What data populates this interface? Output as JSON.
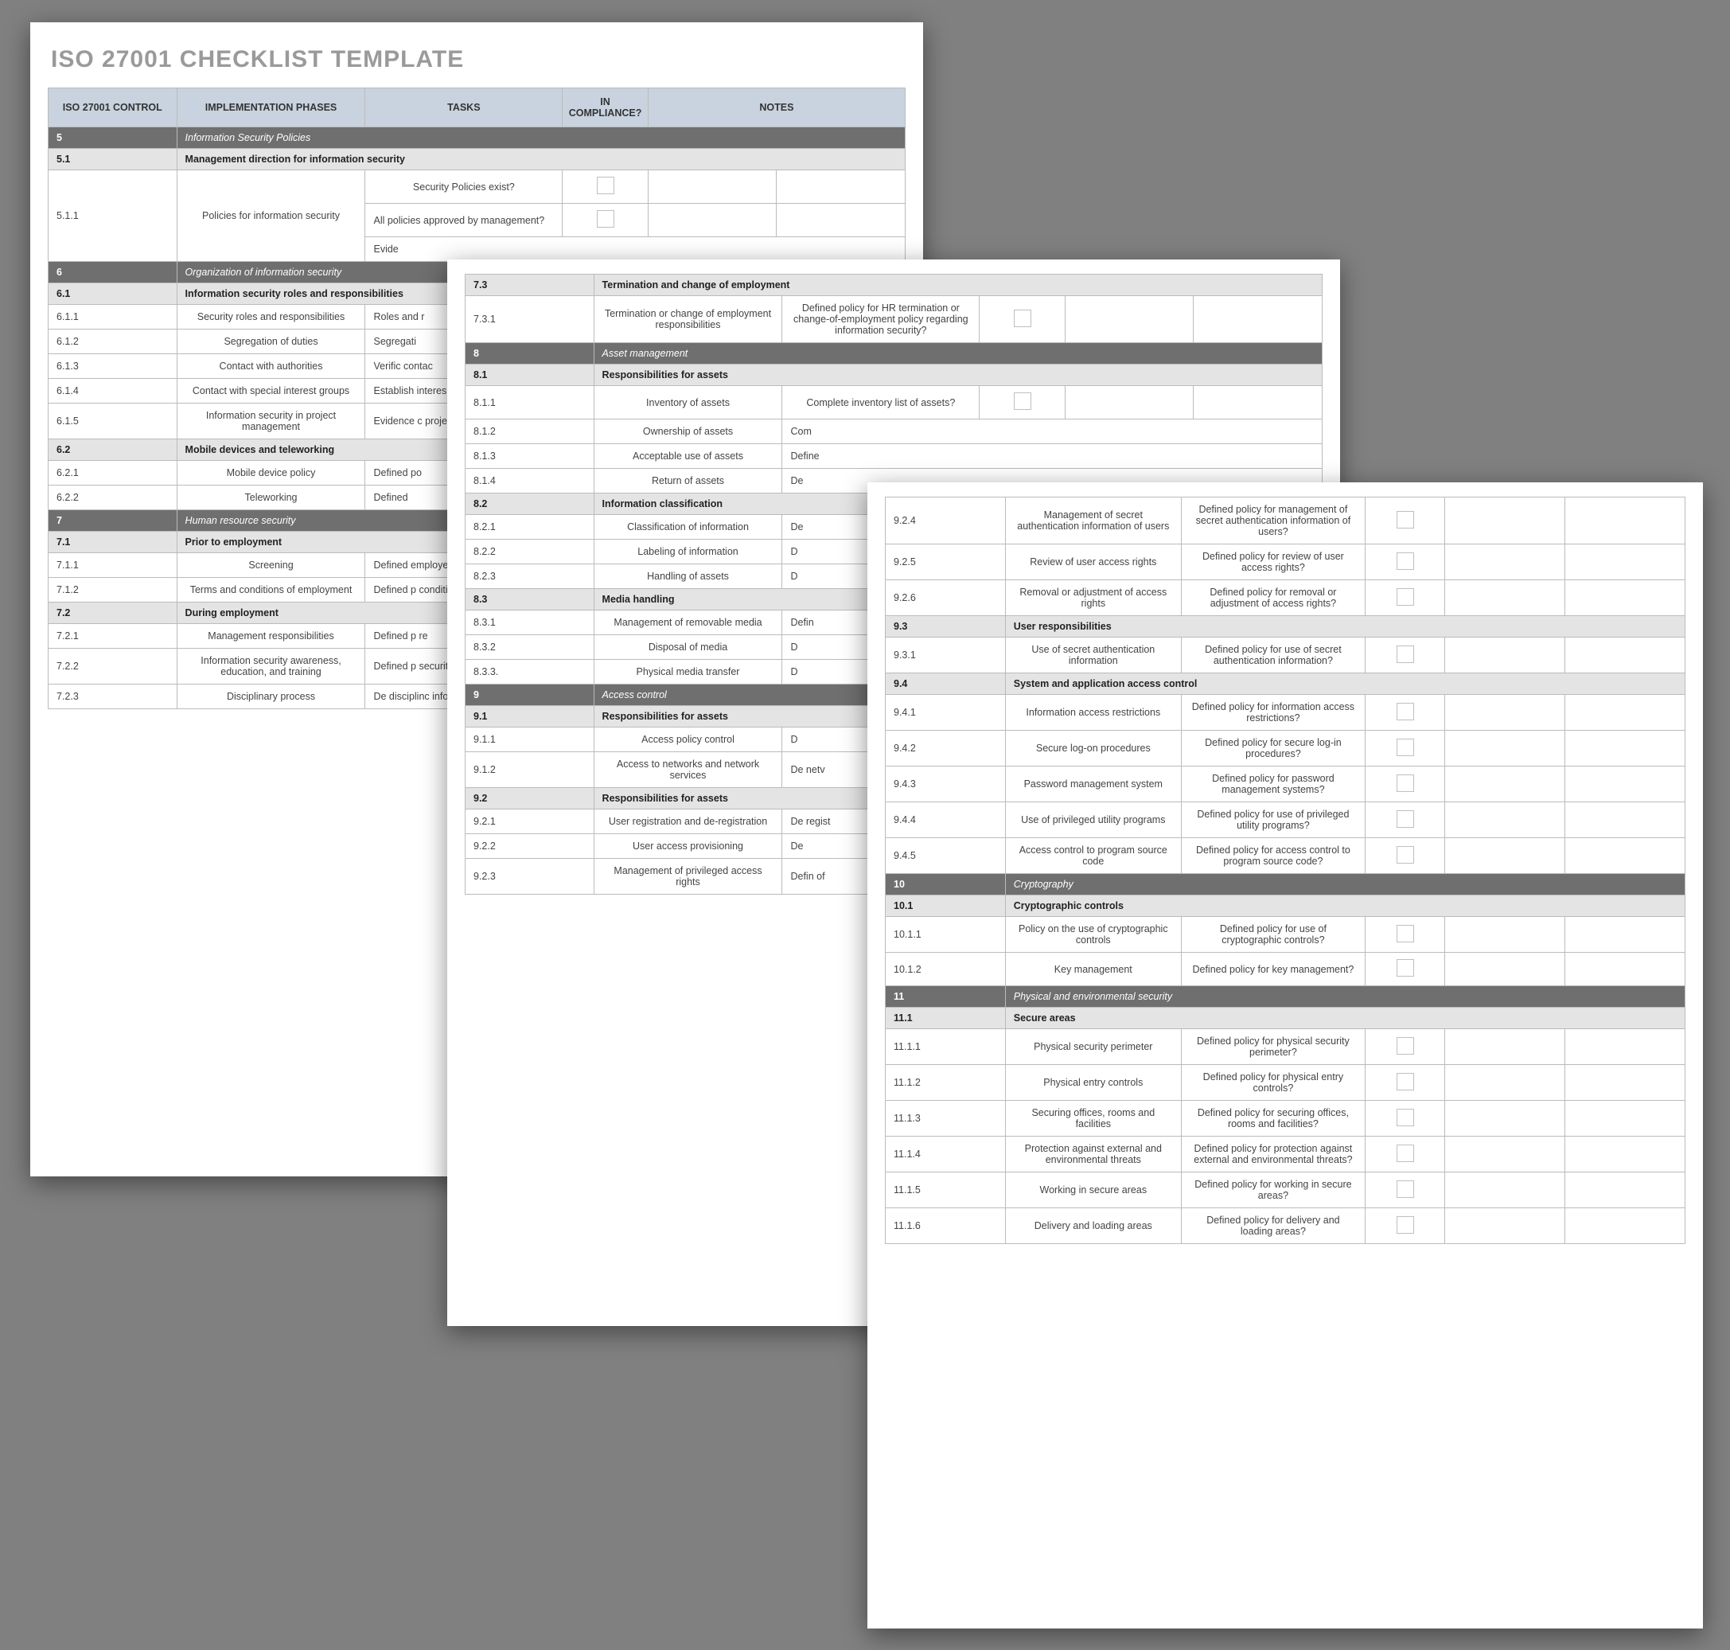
{
  "title": "ISO 27001 CHECKLIST TEMPLATE",
  "headers": {
    "control": "ISO 27001 CONTROL",
    "phases": "IMPLEMENTATION PHASES",
    "tasks": "TASKS",
    "compliance": "IN COMPLIANCE?",
    "notes": "NOTES"
  },
  "pageA": [
    {
      "t": "section",
      "id": "5",
      "label": "Information Security Policies"
    },
    {
      "t": "sub",
      "id": "5.1",
      "label": "Management direction for information security"
    },
    {
      "t": "row3",
      "id": "5.1.1",
      "phase": "Policies for information security",
      "task1": "Security Policies exist?",
      "task2": "All policies approved by management?",
      "task3": "Evide"
    },
    {
      "t": "section",
      "id": "6",
      "label": "Organization of information security"
    },
    {
      "t": "sub",
      "id": "6.1",
      "label": "Information security roles and responsibilities"
    },
    {
      "t": "row",
      "id": "6.1.1",
      "phase": "Security roles and responsibilities",
      "task": "Roles and r"
    },
    {
      "t": "row",
      "id": "6.1.2",
      "phase": "Segregation of duties",
      "task": "Segregati"
    },
    {
      "t": "row",
      "id": "6.1.3",
      "phase": "Contact with authorities",
      "task": "Verific\ncontac"
    },
    {
      "t": "row",
      "id": "6.1.4",
      "phase": "Contact with special interest groups",
      "task": "Establish\ninteres\nc"
    },
    {
      "t": "row",
      "id": "6.1.5",
      "phase": "Information security in project management",
      "task": "Evidence c\nproje"
    },
    {
      "t": "sub",
      "id": "6.2",
      "label": "Mobile devices and teleworking"
    },
    {
      "t": "row",
      "id": "6.2.1",
      "phase": "Mobile device policy",
      "task": "Defined po"
    },
    {
      "t": "row",
      "id": "6.2.2",
      "phase": "Teleworking",
      "task": "Defined"
    },
    {
      "t": "section",
      "id": "7",
      "label": "Human resource security"
    },
    {
      "t": "sub",
      "id": "7.1",
      "label": "Prior to employment"
    },
    {
      "t": "row",
      "id": "7.1.1",
      "phase": "Screening",
      "task": "Defined\nemployees"
    },
    {
      "t": "row",
      "id": "7.1.2",
      "phase": "Terms and conditions of employment",
      "task": "Defined p\nconditi"
    },
    {
      "t": "sub",
      "id": "7.2",
      "label": "During employment"
    },
    {
      "t": "row",
      "id": "7.2.1",
      "phase": "Management responsibilities",
      "task": "Defined p\nre"
    },
    {
      "t": "row",
      "id": "7.2.2",
      "phase": "Information security awareness, education, and training",
      "task": "Defined p\nsecurity c\nc"
    },
    {
      "t": "row",
      "id": "7.2.3",
      "phase": "Disciplinary process",
      "task": "De\ndisciplinc\ninfor"
    }
  ],
  "pageB": [
    {
      "t": "sub",
      "id": "7.3",
      "label": "Termination and change of employment"
    },
    {
      "t": "rowfull",
      "id": "7.3.1",
      "phase": "Termination or change of employment responsibilities",
      "task": "Defined policy for HR termination or change-of-employment policy regarding information security?"
    },
    {
      "t": "section",
      "id": "8",
      "label": "Asset management"
    },
    {
      "t": "sub",
      "id": "8.1",
      "label": "Responsibilities for assets"
    },
    {
      "t": "rowfull",
      "id": "8.1.1",
      "phase": "Inventory of assets",
      "task": "Complete inventory list of assets?"
    },
    {
      "t": "row",
      "id": "8.1.2",
      "phase": "Ownership of assets",
      "task": "Com"
    },
    {
      "t": "row",
      "id": "8.1.3",
      "phase": "Acceptable use of assets",
      "task": "Define"
    },
    {
      "t": "row",
      "id": "8.1.4",
      "phase": "Return of assets",
      "task": "De"
    },
    {
      "t": "sub",
      "id": "8.2",
      "label": "Information classification"
    },
    {
      "t": "row",
      "id": "8.2.1",
      "phase": "Classification of information",
      "task": "De"
    },
    {
      "t": "row",
      "id": "8.2.2",
      "phase": "Labeling of information",
      "task": "D"
    },
    {
      "t": "row",
      "id": "8.2.3",
      "phase": "Handling of assets",
      "task": "D"
    },
    {
      "t": "sub",
      "id": "8.3",
      "label": "Media handling"
    },
    {
      "t": "row",
      "id": "8.3.1",
      "phase": "Management of removable media",
      "task": "Defin"
    },
    {
      "t": "row",
      "id": "8.3.2",
      "phase": "Disposal of media",
      "task": "D"
    },
    {
      "t": "row",
      "id": "8.3.3.",
      "phase": "Physical media transfer",
      "task": "D"
    },
    {
      "t": "section",
      "id": "9",
      "label": "Access control"
    },
    {
      "t": "sub",
      "id": "9.1",
      "label": "Responsibilities for assets"
    },
    {
      "t": "row",
      "id": "9.1.1",
      "phase": "Access policy control",
      "task": "D"
    },
    {
      "t": "row",
      "id": "9.1.2",
      "phase": "Access to networks and network services",
      "task": "De\nnetv"
    },
    {
      "t": "sub",
      "id": "9.2",
      "label": "Responsibilities for assets"
    },
    {
      "t": "row",
      "id": "9.2.1",
      "phase": "User registration and de-registration",
      "task": "De\nregist"
    },
    {
      "t": "row",
      "id": "9.2.2",
      "phase": "User access provisioning",
      "task": "De"
    },
    {
      "t": "row",
      "id": "9.2.3",
      "phase": "Management of privileged access rights",
      "task": "Defin\nof"
    }
  ],
  "pageC": [
    {
      "t": "rowfull",
      "id": "9.2.4",
      "phase": "Management of secret authentication information of users",
      "task": "Defined policy for management of secret authentication information of users?"
    },
    {
      "t": "rowfull",
      "id": "9.2.5",
      "phase": "Review of user access rights",
      "task": "Defined policy for review of user access rights?"
    },
    {
      "t": "rowfull",
      "id": "9.2.6",
      "phase": "Removal or adjustment of access rights",
      "task": "Defined policy for removal or adjustment of access rights?"
    },
    {
      "t": "sub",
      "id": "9.3",
      "label": "User responsibilities"
    },
    {
      "t": "rowfull",
      "id": "9.3.1",
      "phase": "Use of secret authentication information",
      "task": "Defined policy for use of secret authentication information?"
    },
    {
      "t": "sub",
      "id": "9.4",
      "label": "System and application access control"
    },
    {
      "t": "rowfull",
      "id": "9.4.1",
      "phase": "Information access restrictions",
      "task": "Defined policy for information access restrictions?"
    },
    {
      "t": "rowfull",
      "id": "9.4.2",
      "phase": "Secure log-on procedures",
      "task": "Defined policy for secure log-in procedures?"
    },
    {
      "t": "rowfull",
      "id": "9.4.3",
      "phase": "Password management system",
      "task": "Defined policy for password management systems?"
    },
    {
      "t": "rowfull",
      "id": "9.4.4",
      "phase": "Use of privileged utility programs",
      "task": "Defined policy for use of privileged utility programs?"
    },
    {
      "t": "rowfull",
      "id": "9.4.5",
      "phase": "Access control to program source code",
      "task": "Defined policy for access control to program source code?"
    },
    {
      "t": "section",
      "id": "10",
      "label": "Cryptography"
    },
    {
      "t": "sub",
      "id": "10.1",
      "label": "Cryptographic controls"
    },
    {
      "t": "rowfull",
      "id": "10.1.1",
      "phase": "Policy on the use of cryptographic controls",
      "task": "Defined policy for use of cryptographic controls?"
    },
    {
      "t": "rowfull",
      "id": "10.1.2",
      "phase": "Key management",
      "task": "Defined policy for key management?"
    },
    {
      "t": "section",
      "id": "11",
      "label": "Physical and environmental security"
    },
    {
      "t": "sub",
      "id": "11.1",
      "label": "Secure areas"
    },
    {
      "t": "rowfull",
      "id": "11.1.1",
      "phase": "Physical security perimeter",
      "task": "Defined policy for physical security perimeter?"
    },
    {
      "t": "rowfull",
      "id": "11.1.2",
      "phase": "Physical entry controls",
      "task": "Defined policy for physical entry controls?"
    },
    {
      "t": "rowfull",
      "id": "11.1.3",
      "phase": "Securing offices, rooms and facilities",
      "task": "Defined policy for securing offices, rooms and facilities?"
    },
    {
      "t": "rowfull",
      "id": "11.1.4",
      "phase": "Protection against external and environmental threats",
      "task": "Defined policy for protection against external and environmental threats?"
    },
    {
      "t": "rowfull",
      "id": "11.1.5",
      "phase": "Working in secure areas",
      "task": "Defined policy for working in secure areas?"
    },
    {
      "t": "rowfull",
      "id": "11.1.6",
      "phase": "Delivery and loading areas",
      "task": "Defined policy for delivery and loading areas?"
    }
  ]
}
